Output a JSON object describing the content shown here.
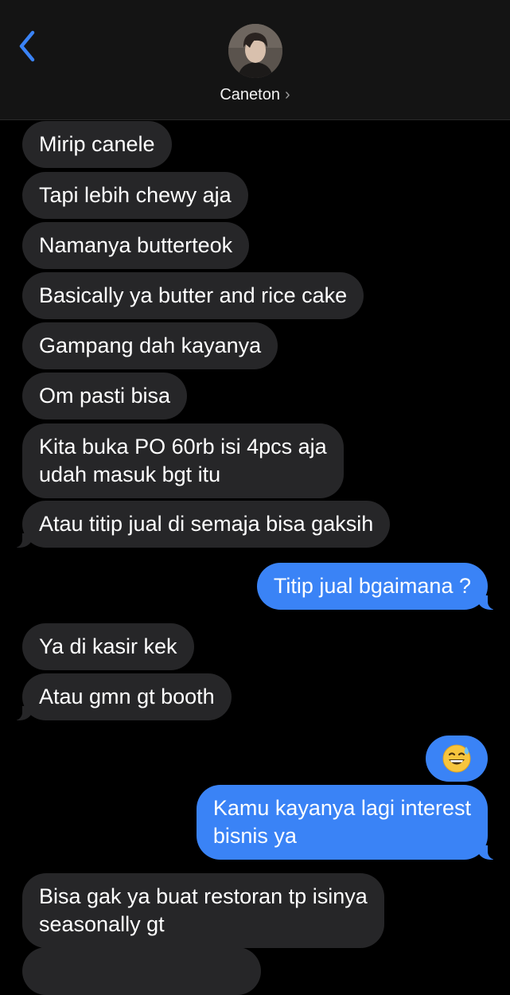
{
  "header": {
    "contact_name": "Caneton",
    "contact_chevron": "›",
    "back_icon": "chevron-left-icon"
  },
  "messages": [
    {
      "side": "in",
      "text": "Mirip canele"
    },
    {
      "side": "in",
      "text": "Tapi lebih chewy aja"
    },
    {
      "side": "in",
      "text": "Namanya butterteok"
    },
    {
      "side": "in",
      "text": "Basically ya butter and rice cake"
    },
    {
      "side": "in",
      "text": "Gampang dah kayanya"
    },
    {
      "side": "in",
      "text": "Om pasti bisa"
    },
    {
      "side": "in",
      "text": "Kita buka PO 60rb isi 4pcs aja\nudah masuk bgt itu"
    },
    {
      "side": "in",
      "text": "Atau titip jual di semaja bisa gaksih"
    },
    {
      "side": "out",
      "text": "Titip jual bgaimana ?"
    },
    {
      "side": "in",
      "text": "Ya di kasir kek"
    },
    {
      "side": "in",
      "text": "Atau gmn gt booth"
    },
    {
      "side": "out",
      "emoji": "grinning-face-with-sweat-emoji"
    },
    {
      "side": "out",
      "text": "Kamu kayanya lagi interest\nbisnis ya"
    },
    {
      "side": "in",
      "text": "Bisa gak ya buat restoran tp isinya\nseasonally gt"
    }
  ],
  "colors": {
    "incoming_bubble": "#262628",
    "outgoing_bubble": "#3a83f6",
    "back_arrow": "#3a83f6",
    "background": "#000000",
    "header": "#141414"
  }
}
